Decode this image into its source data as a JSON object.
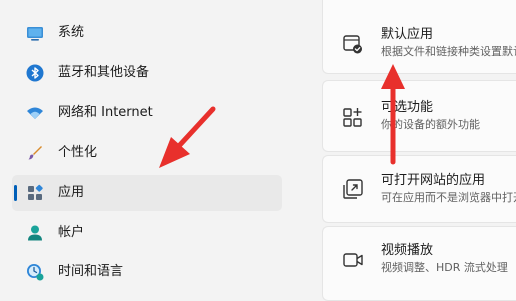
{
  "sidebar": {
    "items": [
      {
        "label": "系统",
        "icon": "monitor-icon"
      },
      {
        "label": "蓝牙和其他设备",
        "icon": "bluetooth-icon"
      },
      {
        "label": "网络和 Internet",
        "icon": "wifi-icon"
      },
      {
        "label": "个性化",
        "icon": "brush-icon"
      },
      {
        "label": "应用",
        "icon": "apps-icon",
        "selected": true
      },
      {
        "label": "帐户",
        "icon": "account-icon"
      },
      {
        "label": "时间和语言",
        "icon": "clock-globe-icon"
      }
    ]
  },
  "cards": [
    {
      "title": "默认应用",
      "subtitle": "根据文件和链接种类设置默认",
      "icon": "default-apps-icon"
    },
    {
      "title": "可选功能",
      "subtitle": "你的设备的额外功能",
      "icon": "optional-features-icon"
    },
    {
      "title": "可打开网站的应用",
      "subtitle": "可在应用而不是浏览器中打开",
      "icon": "apps-for-websites-icon"
    },
    {
      "title": "视频播放",
      "subtitle": "视频调整、HDR 流式处理",
      "icon": "video-camera-icon"
    }
  ],
  "colors": {
    "accent": "#005fb8",
    "arrow": "#e8302c",
    "background": "#f3f3f3",
    "card": "#fbfbfb"
  }
}
